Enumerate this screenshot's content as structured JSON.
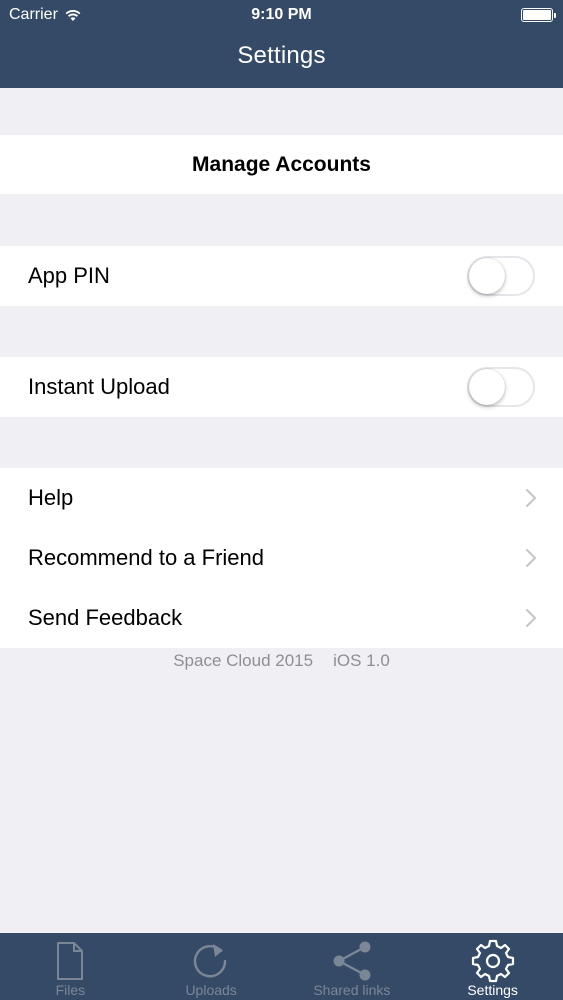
{
  "status_bar": {
    "carrier": "Carrier",
    "time": "9:10 PM",
    "battery_level": 1.0
  },
  "nav": {
    "title": "Settings"
  },
  "manage_accounts": {
    "label": "Manage Accounts"
  },
  "app_pin": {
    "label": "App PIN",
    "enabled": false
  },
  "instant_upload": {
    "label": "Instant Upload",
    "enabled": false
  },
  "menu": {
    "items": [
      {
        "label": "Help",
        "icon": "chevron-right-icon"
      },
      {
        "label": "Recommend to a Friend",
        "icon": "chevron-right-icon"
      },
      {
        "label": "Send Feedback",
        "icon": "chevron-right-icon"
      }
    ]
  },
  "footer": {
    "app": "Space Cloud 2015",
    "version": "iOS 1.0"
  },
  "tabbar": {
    "tabs": [
      {
        "label": "Files",
        "icon": "file-icon",
        "active": false
      },
      {
        "label": "Uploads",
        "icon": "refresh-icon",
        "active": false
      },
      {
        "label": "Shared links",
        "icon": "share-icon",
        "active": false
      },
      {
        "label": "Settings",
        "icon": "gear-icon",
        "active": true
      }
    ]
  },
  "colors": {
    "nav_background": "#344a66",
    "page_background": "#efeff4",
    "tab_inactive": "#7b8697",
    "tab_active": "#ffffff",
    "footer_text": "#8e8e93"
  }
}
